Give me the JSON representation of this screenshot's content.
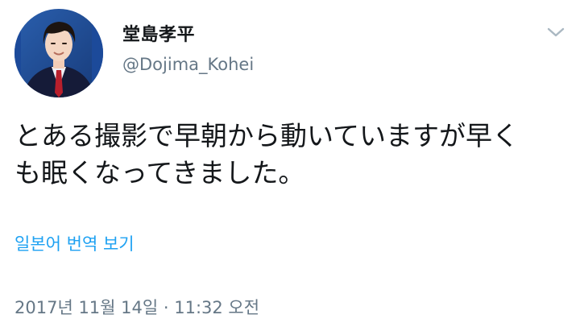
{
  "tweet": {
    "user": {
      "display_name": "堂島孝平",
      "handle": "@Dojima_Kohei",
      "avatar_icon": "user-avatar-photo"
    },
    "more_menu_icon": "chevron-down-icon",
    "text": "とある撮影で早朝から動いていますが早く\nも眠くなってきました。",
    "translate_label": "일본어 번역 보기",
    "timestamp": "2017년 11월 14일 · 11:32 오전",
    "colors": {
      "text": "#14171a",
      "secondary": "#657786",
      "link": "#1da1f2",
      "chevron": "#aab8c2"
    }
  }
}
